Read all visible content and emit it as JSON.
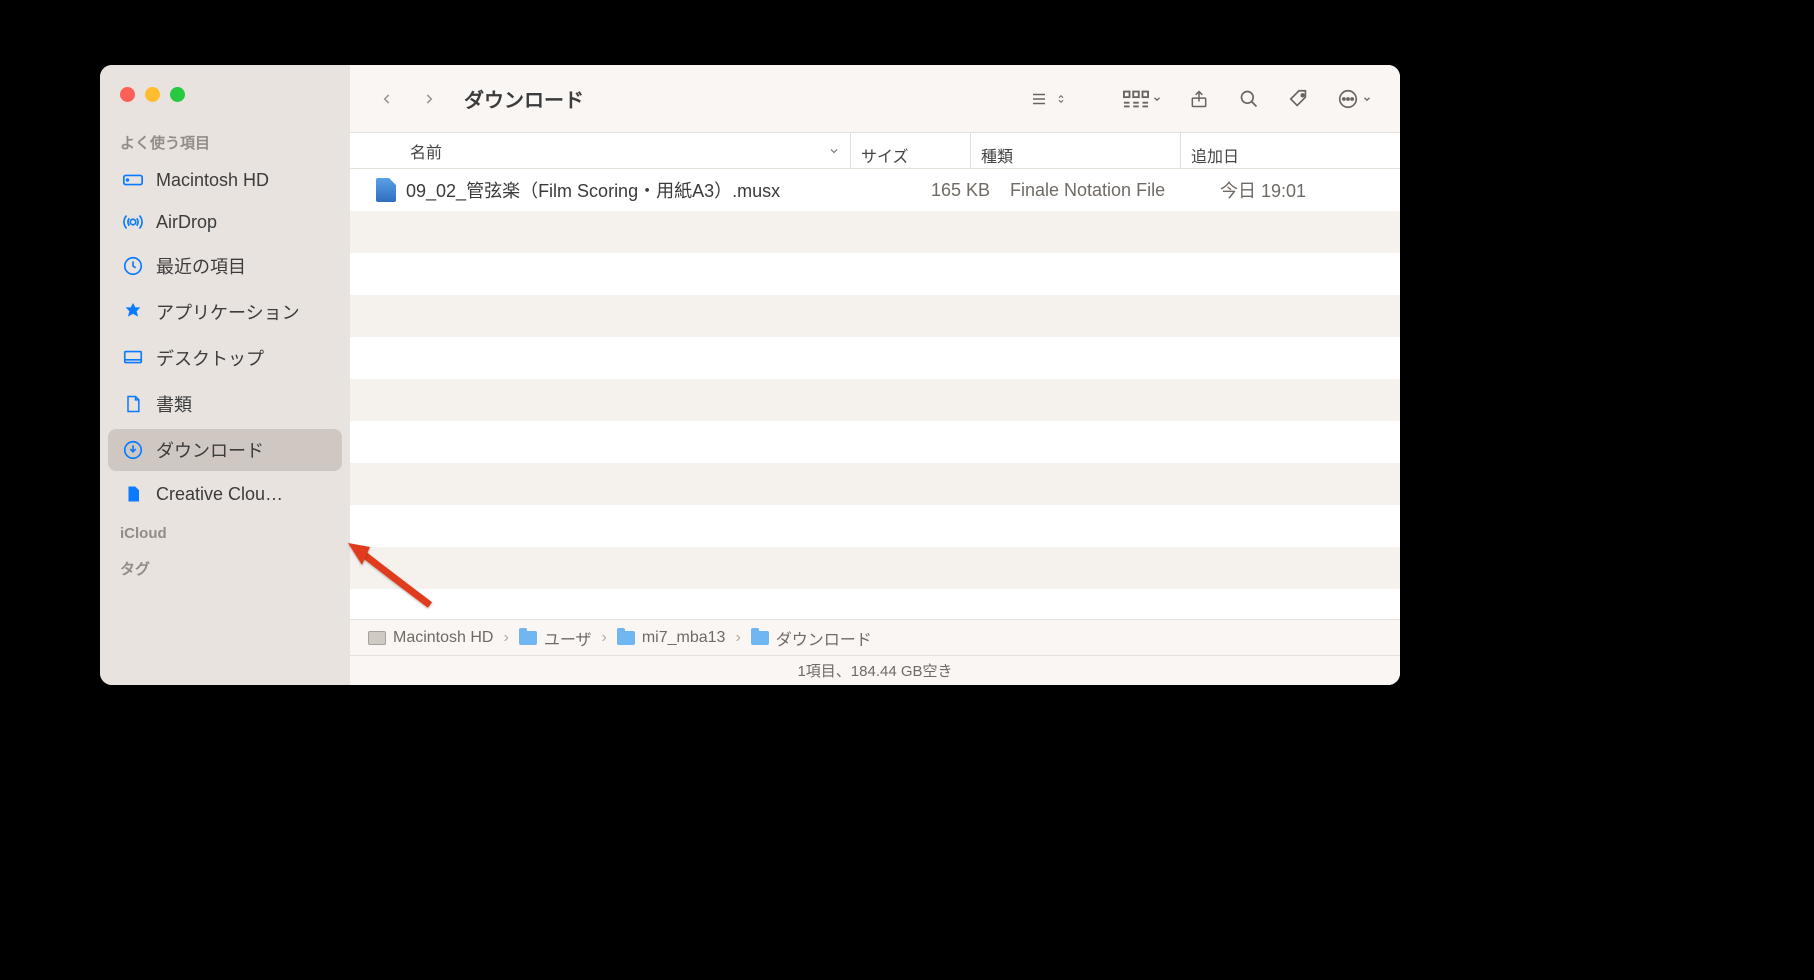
{
  "window_title": "ダウンロード",
  "sidebar": {
    "favorites_label": "よく使う項目",
    "items": [
      {
        "label": "Macintosh HD",
        "icon": "disk"
      },
      {
        "label": "AirDrop",
        "icon": "airdrop"
      },
      {
        "label": "最近の項目",
        "icon": "clock"
      },
      {
        "label": "アプリケーション",
        "icon": "apps"
      },
      {
        "label": "デスクトップ",
        "icon": "desktop"
      },
      {
        "label": "書類",
        "icon": "doc"
      },
      {
        "label": "ダウンロード",
        "icon": "download"
      },
      {
        "label": "Creative Clou…",
        "icon": "file"
      }
    ],
    "icloud_label": "iCloud",
    "tags_label": "タグ"
  },
  "columns": {
    "name": "名前",
    "size": "サイズ",
    "kind": "種類",
    "date_added": "追加日"
  },
  "files": [
    {
      "name": "09_02_管弦楽（Film Scoring・用紙A3）.musx",
      "size": "165 KB",
      "kind": "Finale Notation File",
      "date_added": "今日 19:01"
    }
  ],
  "path": [
    {
      "label": "Macintosh HD",
      "icon": "disk"
    },
    {
      "label": "ユーザ",
      "icon": "folder"
    },
    {
      "label": "mi7_mba13",
      "icon": "folder"
    },
    {
      "label": "ダウンロード",
      "icon": "folder"
    }
  ],
  "status": "1項目、184.44 GB空き"
}
